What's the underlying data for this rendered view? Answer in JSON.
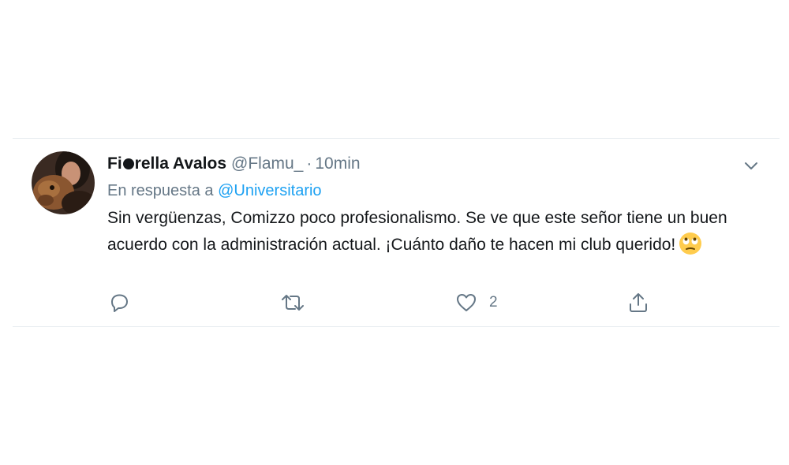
{
  "tweet": {
    "author_name_before": "Fi",
    "author_name_after": "rella Avalos",
    "handle": "@Flamu_",
    "separator": "·",
    "time": "10min",
    "reply_prefix": "En respuesta a",
    "reply_to": "@Universitario",
    "text": "Sin vergüenzas, Comizzo poco profesionalismo. Se ve que este señor tiene un buen acuerdo con la administración actual. ¡Cuánto daño te hacen mi club querido!",
    "emoji": "face-with-rolling-eyes-icon"
  },
  "actions": {
    "reply_icon": "reply-icon",
    "retweet_icon": "retweet-icon",
    "like_icon": "heart-icon",
    "like_count": "2",
    "share_icon": "share-icon"
  },
  "colors": {
    "text": "#14171a",
    "secondary": "#657786",
    "link": "#1da1f2",
    "border": "#e6ecf0"
  }
}
